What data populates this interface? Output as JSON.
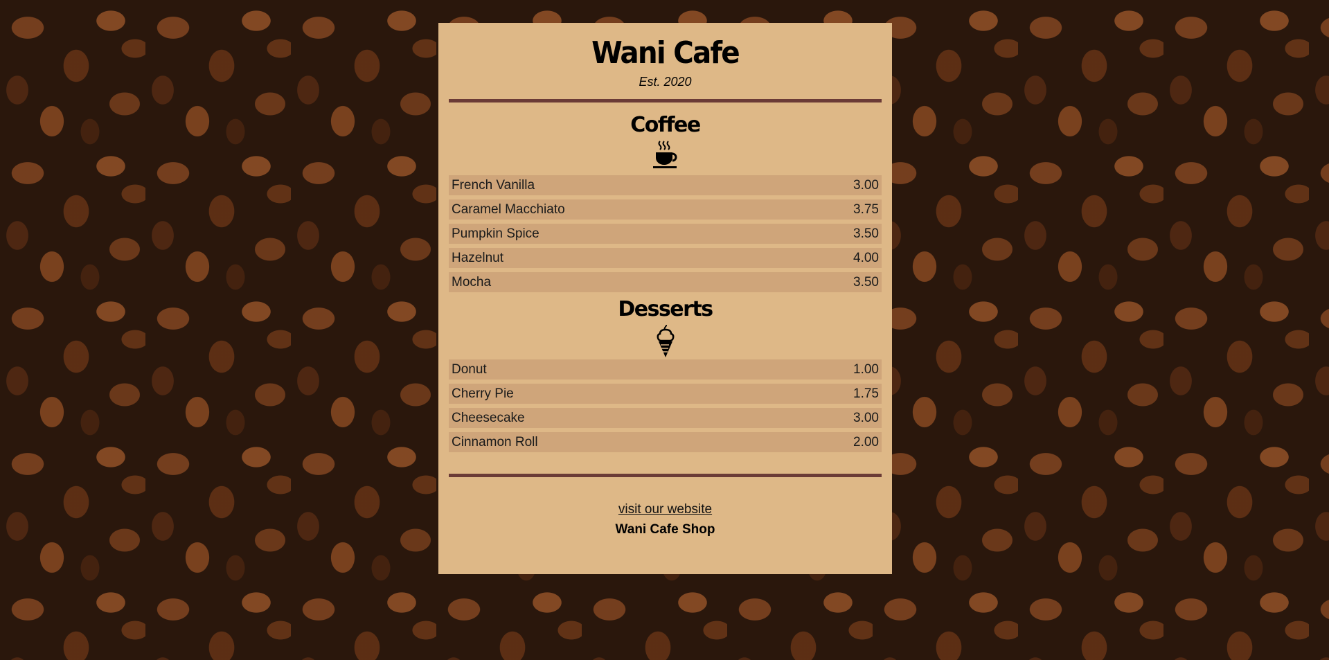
{
  "cafe": {
    "name": "Wani Cafe",
    "established": "Est. 2020"
  },
  "colors": {
    "menu_background": "#deb887",
    "item_background": "#cfa57a",
    "divider": "#6b3b36",
    "page_background": "#2a170c"
  },
  "sections": {
    "coffee": {
      "title": "Coffee",
      "icon": "hot-coffee-cup-icon",
      "items": [
        {
          "name": "French Vanilla",
          "price": "3.00"
        },
        {
          "name": "Caramel Macchiato",
          "price": "3.75"
        },
        {
          "name": "Pumpkin Spice",
          "price": "3.50"
        },
        {
          "name": "Hazelnut",
          "price": "4.00"
        },
        {
          "name": "Mocha",
          "price": "3.50"
        }
      ]
    },
    "desserts": {
      "title": "Desserts",
      "icon": "ice-cream-cone-icon",
      "items": [
        {
          "name": "Donut",
          "price": "1.00"
        },
        {
          "name": "Cherry Pie",
          "price": "1.75"
        },
        {
          "name": "Cheesecake",
          "price": "3.00"
        },
        {
          "name": "Cinnamon Roll",
          "price": "2.00"
        }
      ]
    }
  },
  "footer": {
    "link_text": "visit our website",
    "shop_name": "Wani Cafe Shop"
  }
}
